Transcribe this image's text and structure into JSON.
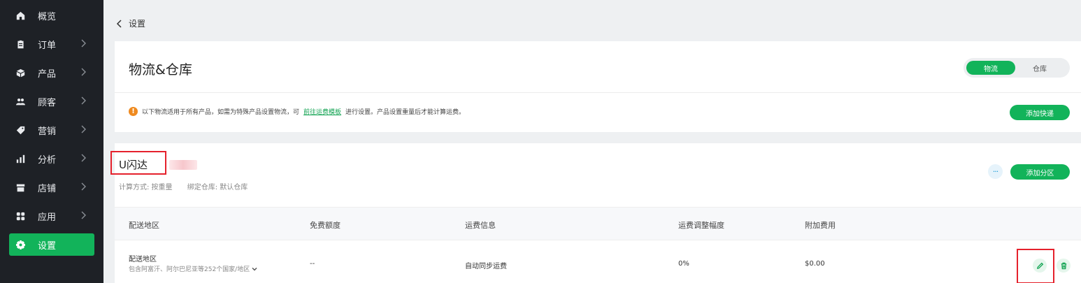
{
  "sidebar": {
    "items": [
      {
        "label": "概览",
        "icon": "home-icon",
        "has_chevron": false
      },
      {
        "label": "订单",
        "icon": "clipboard-icon",
        "has_chevron": true
      },
      {
        "label": "产品",
        "icon": "box-icon",
        "has_chevron": true
      },
      {
        "label": "顾客",
        "icon": "users-icon",
        "has_chevron": true
      },
      {
        "label": "营销",
        "icon": "tag-icon",
        "has_chevron": true
      },
      {
        "label": "分析",
        "icon": "bar-chart-icon",
        "has_chevron": true
      },
      {
        "label": "店铺",
        "icon": "store-icon",
        "has_chevron": true
      },
      {
        "label": "应用",
        "icon": "apps-grid-icon",
        "has_chevron": true
      },
      {
        "label": "设置",
        "icon": "gear-icon",
        "has_chevron": false,
        "active": true
      }
    ]
  },
  "breadcrumb": {
    "back_label": "设置"
  },
  "header_card": {
    "title": "物流&仓库",
    "segments": {
      "logistics": "物流",
      "warehouse": "仓库",
      "selected": "物流"
    },
    "notice": {
      "prefix": "以下物流适用于所有产品，如需为特殊产品设置物流，可",
      "link": "前往运费模板",
      "suffix": "进行设置。产品设置重量后才能计算运费。"
    },
    "add_carrier_label": "添加快递"
  },
  "carrier_card": {
    "name": "U闪达",
    "calc_method": "计算方式: 按重量",
    "warehouse": "绑定仓库: 默认仓库",
    "more_label": "···",
    "add_zone_label": "添加分区",
    "table": {
      "headers": [
        "配送地区",
        "免费额度",
        "运费信息",
        "运费调整幅度",
        "附加费用"
      ],
      "rows": [
        {
          "region_title": "配送地区",
          "region_detail": "包含阿富汗、阿尔巴尼亚等252个国家/地区",
          "free_quota": "--",
          "shipping_info": "自动同步运费",
          "adjustment": "0%",
          "extra_fee": "$0.00"
        }
      ]
    }
  },
  "colors": {
    "accent": "#12b35a",
    "sidebar_bg": "#1e2126",
    "highlight": "#e5212c",
    "warning": "#ef8a1f"
  }
}
